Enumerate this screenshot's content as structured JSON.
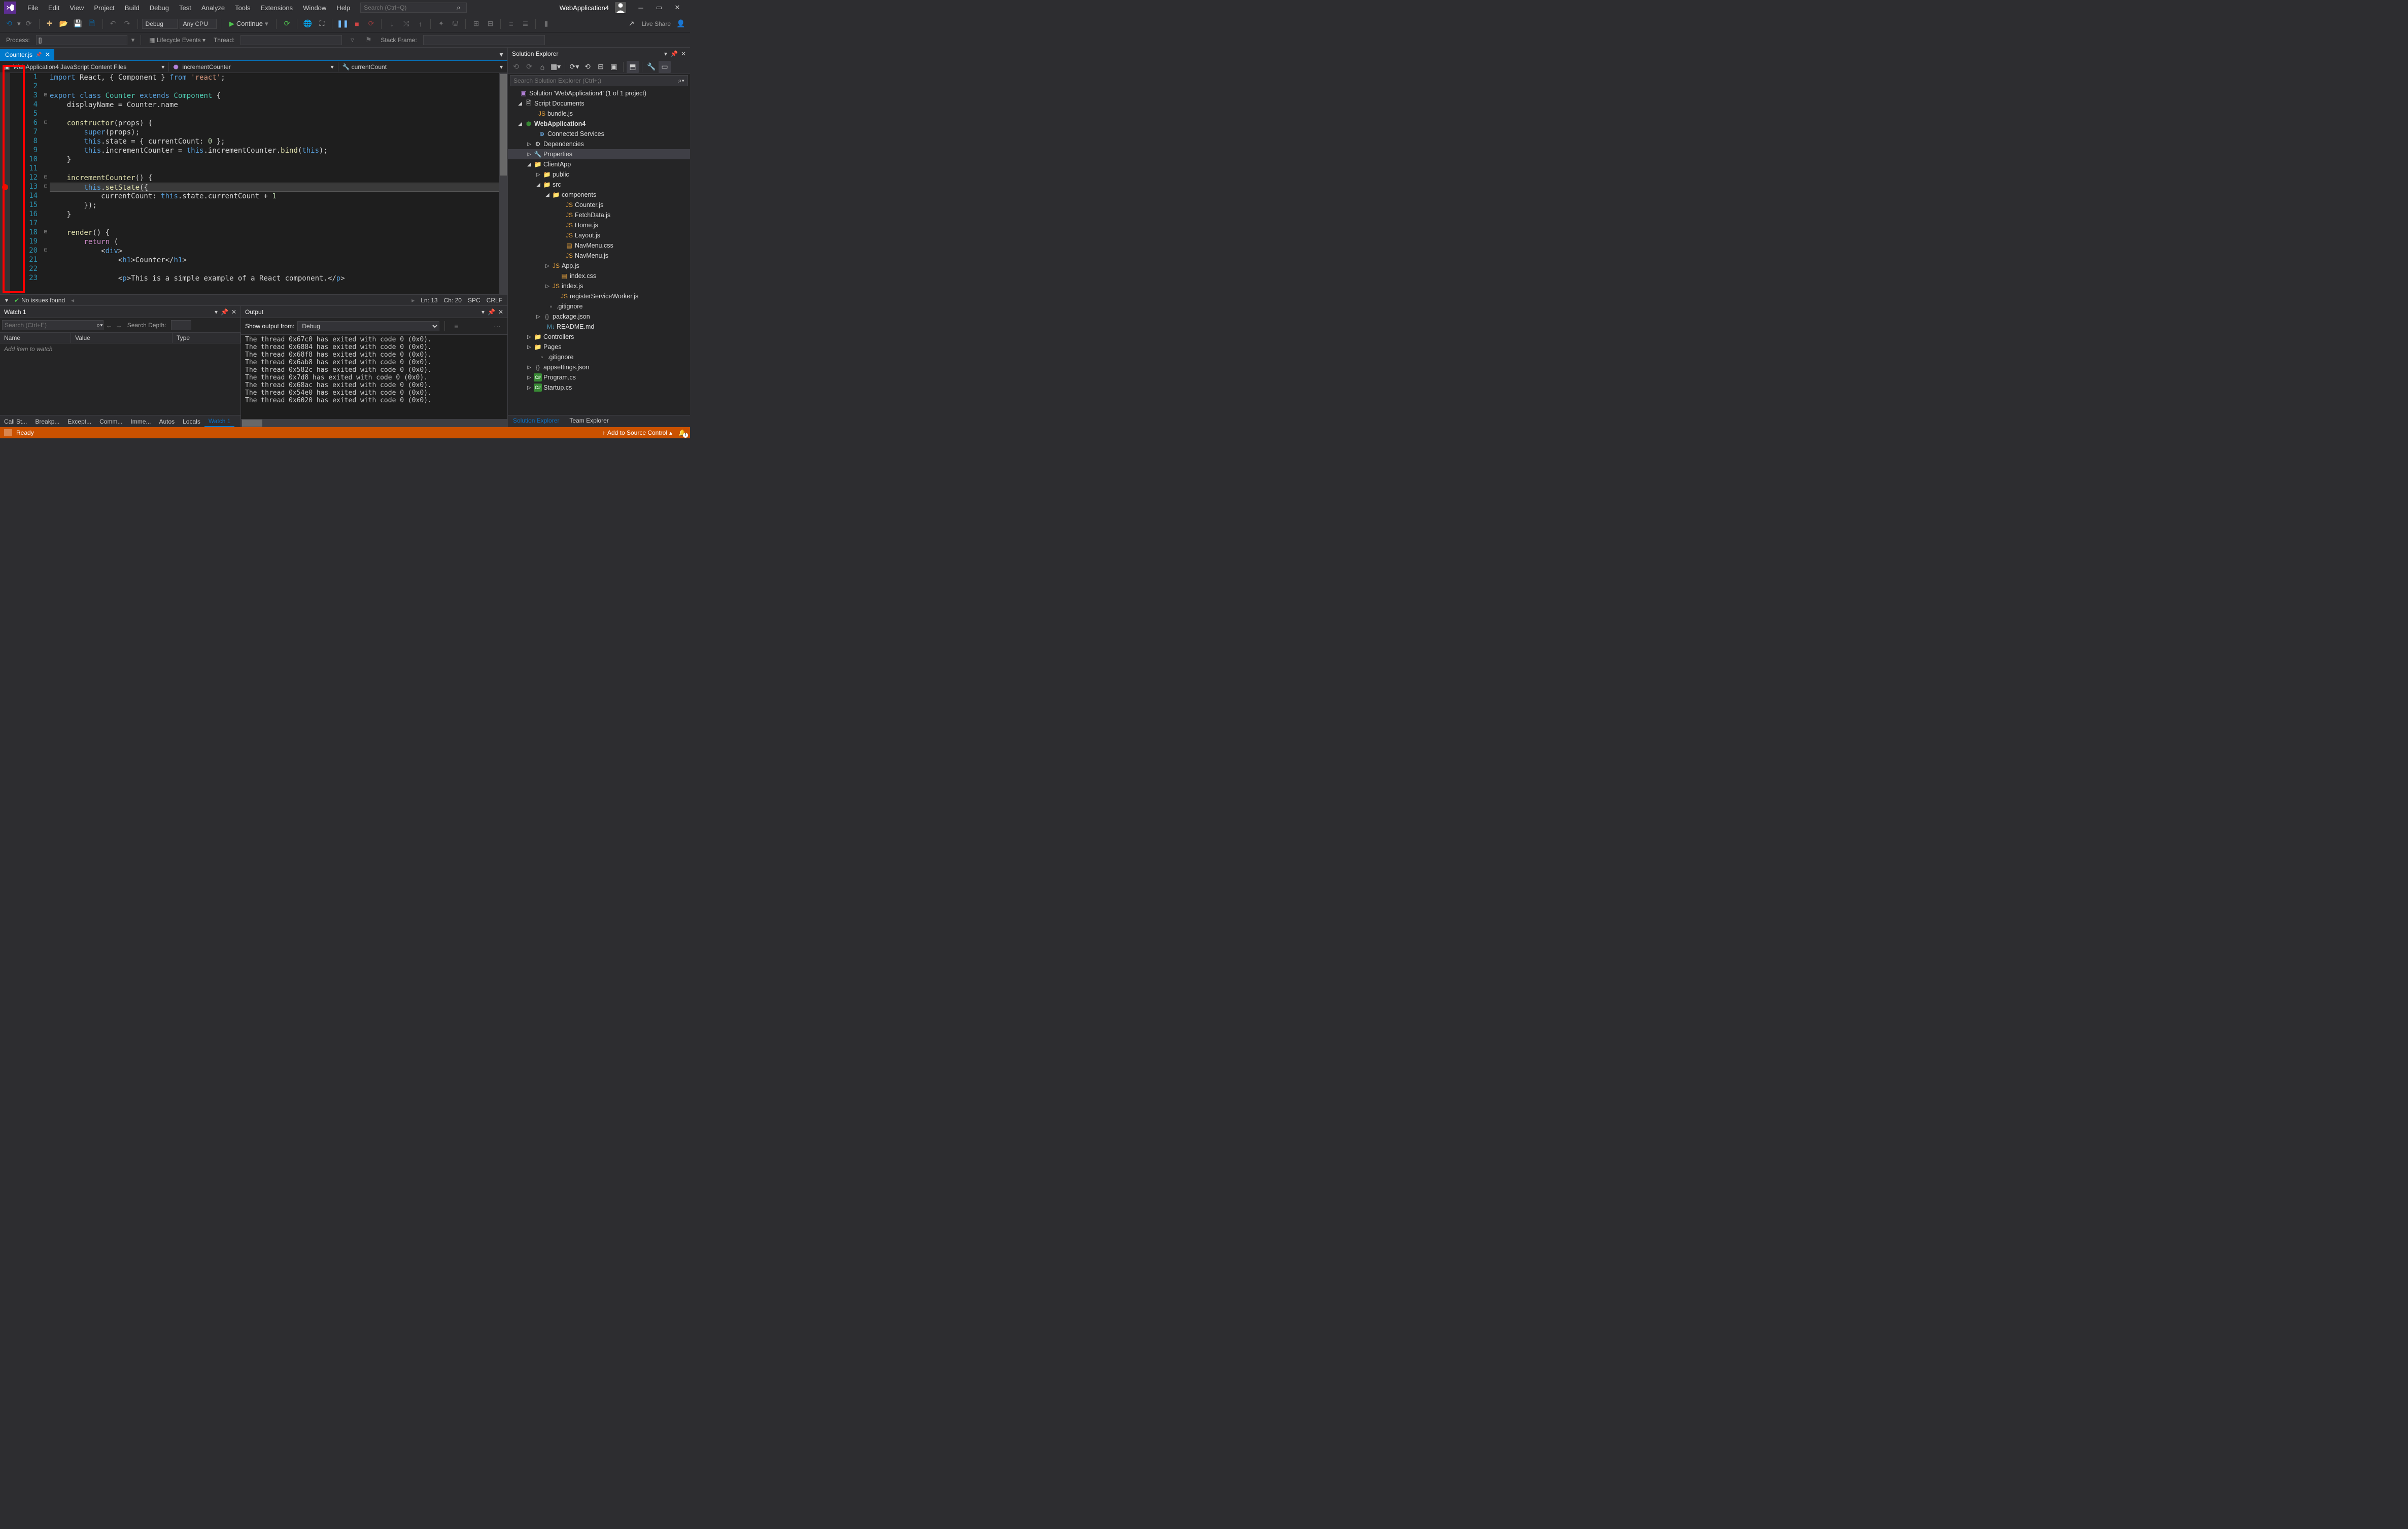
{
  "titlebar": {
    "menus": [
      "File",
      "Edit",
      "View",
      "Project",
      "Build",
      "Debug",
      "Test",
      "Analyze",
      "Tools",
      "Extensions",
      "Window",
      "Help"
    ],
    "search_placeholder": "Search (Ctrl+Q)",
    "app_title": "WebApplication4"
  },
  "toolbar": {
    "config": "Debug",
    "platform": "Any CPU",
    "continue_label": "Continue",
    "live_share": "Live Share"
  },
  "toolbar2": {
    "process_label": "Process:",
    "process_value": "[]",
    "lifecycle": "Lifecycle Events",
    "thread_label": "Thread:",
    "stackframe_label": "Stack Frame:"
  },
  "editor": {
    "tab_name": "Counter.js",
    "breadcrumb1": "WebApplication4 JavaScript Content Files",
    "breadcrumb2": "incrementCounter",
    "breadcrumb3": "currentCount",
    "lines": [
      {
        "n": 1,
        "fold": "",
        "html": "<span class='kw'>import</span><span class='pln'> React, { Component } </span><span class='kw'>from</span><span class='pln'> </span><span class='str'>'react'</span><span class='pln'>;</span>"
      },
      {
        "n": 2,
        "fold": "",
        "html": ""
      },
      {
        "n": 3,
        "fold": "⊟",
        "html": "<span class='kw'>export</span><span class='pln'> </span><span class='kw'>class</span><span class='pln'> </span><span class='type'>Counter</span><span class='pln'> </span><span class='kw'>extends</span><span class='pln'> </span><span class='type'>Component</span><span class='pln'> {</span>"
      },
      {
        "n": 4,
        "fold": "",
        "html": "<span class='pln'>    displayName = Counter.name</span>"
      },
      {
        "n": 5,
        "fold": "",
        "html": ""
      },
      {
        "n": 6,
        "fold": "⊟",
        "html": "<span class='pln'>    </span><span class='fn'>constructor</span><span class='pln'>(props) {</span>"
      },
      {
        "n": 7,
        "fold": "",
        "html": "<span class='pln'>        </span><span class='kw'>super</span><span class='pln'>(props);</span>"
      },
      {
        "n": 8,
        "fold": "",
        "html": "<span class='pln'>        </span><span class='kw'>this</span><span class='pln'>.state = { currentCount: </span><span class='num'>0</span><span class='pln'> };</span>"
      },
      {
        "n": 9,
        "fold": "",
        "html": "<span class='pln'>        </span><span class='kw'>this</span><span class='pln'>.incrementCounter = </span><span class='kw'>this</span><span class='pln'>.incrementCounter.</span><span class='fn'>bind</span><span class='pln'>(</span><span class='kw'>this</span><span class='pln'>);</span>"
      },
      {
        "n": 10,
        "fold": "",
        "html": "<span class='pln'>    }</span>"
      },
      {
        "n": 11,
        "fold": "",
        "html": ""
      },
      {
        "n": 12,
        "fold": "⊟",
        "html": "<span class='pln'>    </span><span class='fn'>incrementCounter</span><span class='pln'>() {</span>"
      },
      {
        "n": 13,
        "fold": "⊟",
        "html": "<span class='pln'>        </span><span class='kw'>this</span><span class='pln'>.</span><span class='fn'>setState</span><span class='pln'>({</span>",
        "hl": true,
        "bp": true
      },
      {
        "n": 14,
        "fold": "",
        "html": "<span class='pln'>            currentCount: </span><span class='kw'>this</span><span class='pln'>.state.currentCount + </span><span class='num'>1</span>"
      },
      {
        "n": 15,
        "fold": "",
        "html": "<span class='pln'>        });</span>"
      },
      {
        "n": 16,
        "fold": "",
        "html": "<span class='pln'>    }</span>"
      },
      {
        "n": 17,
        "fold": "",
        "html": ""
      },
      {
        "n": 18,
        "fold": "⊟",
        "html": "<span class='pln'>    </span><span class='fn'>render</span><span class='pln'>() {</span>"
      },
      {
        "n": 19,
        "fold": "",
        "html": "<span class='pln'>        </span><span class='kw2'>return</span><span class='pln'> (</span>"
      },
      {
        "n": 20,
        "fold": "⊟",
        "html": "<span class='pln'>            &lt;</span><span class='tag'>div</span><span class='pln'>&gt;</span>"
      },
      {
        "n": 21,
        "fold": "",
        "html": "<span class='pln'>                &lt;</span><span class='tag'>h1</span><span class='pln'>&gt;Counter&lt;/</span><span class='tag'>h1</span><span class='pln'>&gt;</span>"
      },
      {
        "n": 22,
        "fold": "",
        "html": ""
      },
      {
        "n": 23,
        "fold": "",
        "html": "<span class='pln'>                &lt;</span><span class='tag'>p</span><span class='pln'>&gt;This is a simple example of a React component.&lt;/</span><span class='tag'>p</span><span class='pln'>&gt;</span>"
      }
    ],
    "status": {
      "issues": "No issues found",
      "ln": "Ln: 13",
      "ch": "Ch: 20",
      "spc": "SPC",
      "crlf": "CRLF"
    }
  },
  "watch": {
    "title": "Watch 1",
    "search_placeholder": "Search (Ctrl+E)",
    "depth_label": "Search Depth:",
    "cols": {
      "name": "Name",
      "value": "Value",
      "type": "Type"
    },
    "placeholder": "Add item to watch",
    "footer_tabs": [
      "Call St...",
      "Breakp...",
      "Except...",
      "Comm...",
      "Imme...",
      "Autos",
      "Locals",
      "Watch 1"
    ]
  },
  "output": {
    "title": "Output",
    "from_label": "Show output from:",
    "source": "Debug",
    "lines": [
      "The thread 0x67c0 has exited with code 0 (0x0).",
      "The thread 0x6884 has exited with code 0 (0x0).",
      "The thread 0x68f8 has exited with code 0 (0x0).",
      "The thread 0x6ab8 has exited with code 0 (0x0).",
      "The thread 0x582c has exited with code 0 (0x0).",
      "The thread 0x7d8 has exited with code 0 (0x0).",
      "The thread 0x68ac has exited with code 0 (0x0).",
      "The thread 0x54e0 has exited with code 0 (0x0).",
      "The thread 0x6020 has exited with code 0 (0x0)."
    ]
  },
  "solution": {
    "title": "Solution Explorer",
    "search_placeholder": "Search Solution Explorer (Ctrl+;)",
    "tree": [
      {
        "ind": 8,
        "exp": "",
        "ico": "sol",
        "glyph": "▣",
        "label": "Solution 'WebApplication4' (1 of 1 project)"
      },
      {
        "ind": 18,
        "exp": "◢",
        "ico": "",
        "glyph": "🗎",
        "label": "Script Documents"
      },
      {
        "ind": 44,
        "exp": "",
        "ico": "js",
        "glyph": "JS",
        "label": "bundle.js"
      },
      {
        "ind": 18,
        "exp": "◢",
        "ico": "proj",
        "glyph": "⬢",
        "label": "WebApplication4",
        "bold": true
      },
      {
        "ind": 44,
        "exp": "",
        "ico": "globe",
        "glyph": "⊕",
        "label": "Connected Services"
      },
      {
        "ind": 36,
        "exp": "▷",
        "ico": "",
        "glyph": "⚙",
        "label": "Dependencies"
      },
      {
        "ind": 36,
        "exp": "▷",
        "ico": "wrench",
        "glyph": "🔧",
        "label": "Properties",
        "sel": true
      },
      {
        "ind": 36,
        "exp": "◢",
        "ico": "folder",
        "glyph": "📁",
        "label": "ClientApp"
      },
      {
        "ind": 54,
        "exp": "▷",
        "ico": "folder",
        "glyph": "📁",
        "label": "public"
      },
      {
        "ind": 54,
        "exp": "◢",
        "ico": "folder",
        "glyph": "📁",
        "label": "src"
      },
      {
        "ind": 72,
        "exp": "◢",
        "ico": "folder",
        "glyph": "📁",
        "label": "components"
      },
      {
        "ind": 98,
        "exp": "",
        "ico": "js",
        "glyph": "JS",
        "label": "Counter.js"
      },
      {
        "ind": 98,
        "exp": "",
        "ico": "js",
        "glyph": "JS",
        "label": "FetchData.js"
      },
      {
        "ind": 98,
        "exp": "",
        "ico": "js",
        "glyph": "JS",
        "label": "Home.js"
      },
      {
        "ind": 98,
        "exp": "",
        "ico": "js",
        "glyph": "JS",
        "label": "Layout.js"
      },
      {
        "ind": 98,
        "exp": "",
        "ico": "css",
        "glyph": "▤",
        "label": "NavMenu.css"
      },
      {
        "ind": 98,
        "exp": "",
        "ico": "js",
        "glyph": "JS",
        "label": "NavMenu.js"
      },
      {
        "ind": 72,
        "exp": "▷",
        "ico": "js",
        "glyph": "JS",
        "label": "App.js"
      },
      {
        "ind": 88,
        "exp": "",
        "ico": "css",
        "glyph": "▤",
        "label": "index.css"
      },
      {
        "ind": 72,
        "exp": "▷",
        "ico": "js",
        "glyph": "JS",
        "label": "index.js"
      },
      {
        "ind": 88,
        "exp": "",
        "ico": "js",
        "glyph": "JS",
        "label": "registerServiceWorker.js"
      },
      {
        "ind": 62,
        "exp": "",
        "ico": "",
        "glyph": "▫",
        "label": ".gitignore"
      },
      {
        "ind": 54,
        "exp": "▷",
        "ico": "json",
        "glyph": "{}",
        "label": "package.json"
      },
      {
        "ind": 62,
        "exp": "",
        "ico": "md",
        "glyph": "M↓",
        "label": "README.md"
      },
      {
        "ind": 36,
        "exp": "▷",
        "ico": "folder",
        "glyph": "📁",
        "label": "Controllers"
      },
      {
        "ind": 36,
        "exp": "▷",
        "ico": "folder",
        "glyph": "📁",
        "label": "Pages"
      },
      {
        "ind": 44,
        "exp": "",
        "ico": "",
        "glyph": "▫",
        "label": ".gitignore"
      },
      {
        "ind": 36,
        "exp": "▷",
        "ico": "json",
        "glyph": "{}",
        "label": "appsettings.json"
      },
      {
        "ind": 36,
        "exp": "▷",
        "ico": "csharp",
        "glyph": "C#",
        "label": "Program.cs"
      },
      {
        "ind": 36,
        "exp": "▷",
        "ico": "csharp",
        "glyph": "C#",
        "label": "Startup.cs"
      }
    ],
    "footer_tabs": [
      "Solution Explorer",
      "Team Explorer"
    ]
  },
  "statusbar": {
    "ready": "Ready",
    "source_control": "Add to Source Control"
  }
}
